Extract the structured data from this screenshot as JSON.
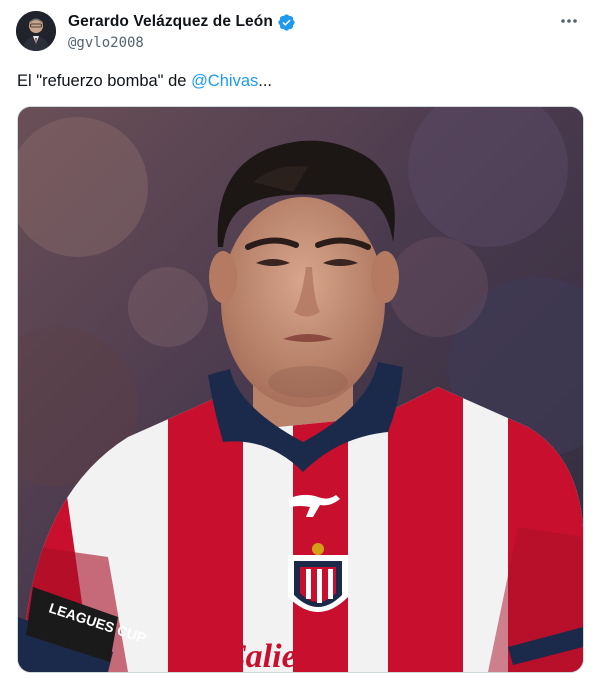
{
  "author": {
    "display_name": "Gerardo Velázquez de León",
    "handle": "@gvlo2008",
    "verified": true,
    "avatar_icon": "profile-photo"
  },
  "tweet": {
    "text_before": "El \"refuerzo bomba\" de ",
    "mention": "@Chivas",
    "text_after": "..."
  },
  "media": {
    "sleeve_patch": "LEAGUES CUP",
    "shirt_sponsor": "Caliente"
  },
  "colors": {
    "accent": "#1d9bf0",
    "secondary_text": "#536471",
    "jersey_red": "#c8102e",
    "jersey_navy": "#1b2a4a"
  },
  "icons": [
    "verified-badge-icon",
    "more-options-icon"
  ]
}
